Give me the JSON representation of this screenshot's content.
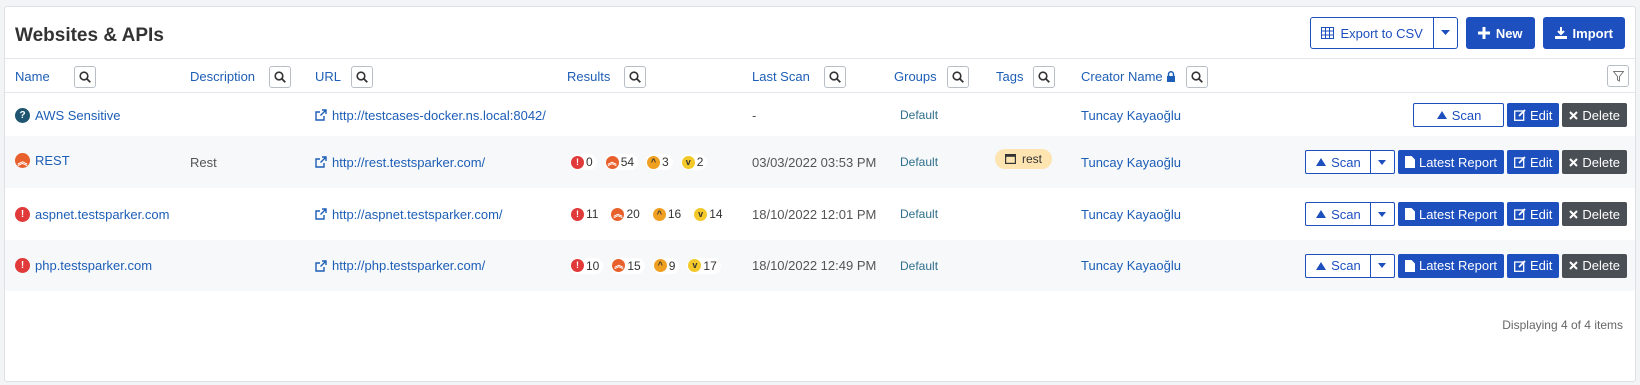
{
  "header": {
    "title": "Websites & APIs",
    "export_label": "Export to CSV",
    "new_label": "New",
    "import_label": "Import"
  },
  "columns": {
    "name": "Name",
    "description": "Description",
    "url": "URL",
    "results": "Results",
    "last_scan": "Last Scan",
    "groups": "Groups",
    "tags": "Tags",
    "creator": "Creator Name"
  },
  "rows": [
    {
      "name": "AWS Sensitive",
      "status_icon": "question-icon",
      "description": "",
      "url": "http://testcases-docker.ns.local:8042/",
      "results": null,
      "last_scan": "-",
      "group": "Default",
      "tag": "",
      "creator": "Tuncay Kayaoğlu",
      "scan_label": "Scan",
      "edit_label": "Edit",
      "delete_label": "Delete"
    },
    {
      "name": "REST",
      "status_icon": "high-severity-icon",
      "description": "Rest",
      "url": "http://rest.testsparker.com/",
      "results": {
        "critical": "0",
        "high": "54",
        "medium": "3",
        "low": "2"
      },
      "last_scan": "03/03/2022 03:53 PM",
      "group": "Default",
      "tag": "rest",
      "creator": "Tuncay Kayaoğlu",
      "scan_label": "Scan",
      "report_label": "Latest Report",
      "edit_label": "Edit",
      "delete_label": "Delete"
    },
    {
      "name": "aspnet.testsparker.com",
      "status_icon": "critical-severity-icon",
      "description": "",
      "url": "http://aspnet.testsparker.com/",
      "results": {
        "critical": "11",
        "high": "20",
        "medium": "16",
        "low": "14"
      },
      "last_scan": "18/10/2022 12:01 PM",
      "group": "Default",
      "tag": "",
      "creator": "Tuncay Kayaoğlu",
      "scan_label": "Scan",
      "report_label": "Latest Report",
      "edit_label": "Edit",
      "delete_label": "Delete"
    },
    {
      "name": "php.testsparker.com",
      "status_icon": "critical-severity-icon",
      "description": "",
      "url": "http://php.testsparker.com/",
      "results": {
        "critical": "10",
        "high": "15",
        "medium": "9",
        "low": "17"
      },
      "last_scan": "18/10/2022 12:49 PM",
      "group": "Default",
      "tag": "",
      "creator": "Tuncay Kayaoğlu",
      "scan_label": "Scan",
      "report_label": "Latest Report",
      "edit_label": "Edit",
      "delete_label": "Delete"
    }
  ],
  "footer": {
    "status": "Displaying 4 of 4 items"
  },
  "colors": {
    "primary": "#1d4fbf",
    "link": "#1d5eb6",
    "critical": "#e03a3a",
    "high": "#e8602c",
    "medium": "#f0a020",
    "low": "#f3c829",
    "delete": "#4a4f55",
    "tag": "#fde4b0"
  }
}
